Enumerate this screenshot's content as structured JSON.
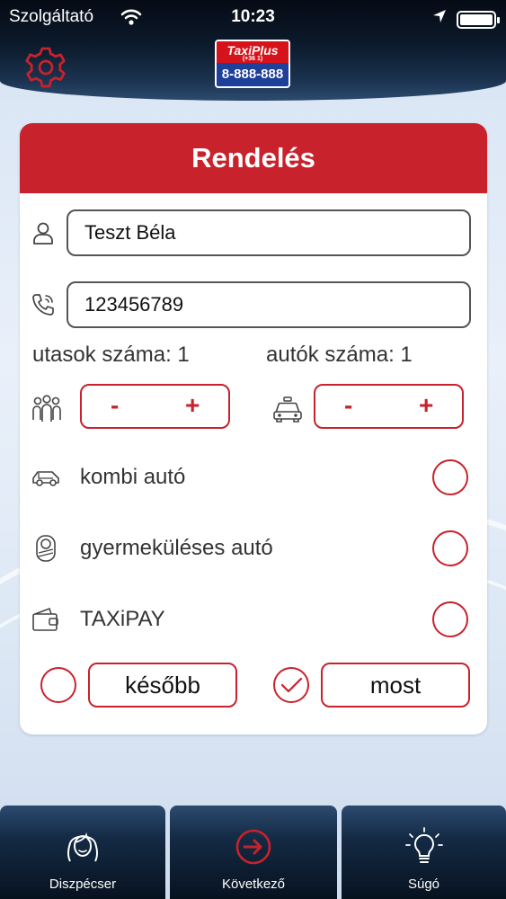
{
  "status_bar": {
    "carrier": "Szolgáltató",
    "time": "10:23"
  },
  "header": {
    "logo_brand": "TaxiPlus",
    "logo_prefix": "(+36 1)",
    "logo_phone": "8-888-888"
  },
  "card": {
    "title": "Rendelés",
    "name_value": "Teszt Béla",
    "phone_value": "123456789",
    "passengers_label": "utasok száma: 1",
    "cars_label": "autók száma: 1",
    "stepper_minus": "-",
    "stepper_plus": "+",
    "options": [
      {
        "label": "kombi autó",
        "checked": false
      },
      {
        "label": "gyermeküléses autó",
        "checked": false
      },
      {
        "label": "TAXiPAY",
        "checked": false
      }
    ],
    "later_label": "később",
    "later_selected": false,
    "now_label": "most",
    "now_selected": true
  },
  "tabs": [
    {
      "label": "Diszpécser",
      "icon": "woman-face-icon"
    },
    {
      "label": "Következő",
      "icon": "arrow-right-circle-icon"
    },
    {
      "label": "Súgó",
      "icon": "lightbulb-icon"
    }
  ],
  "colors": {
    "accent": "#c8222c",
    "header_dark": "#0c1a2c",
    "background": "#e3ecf7"
  }
}
